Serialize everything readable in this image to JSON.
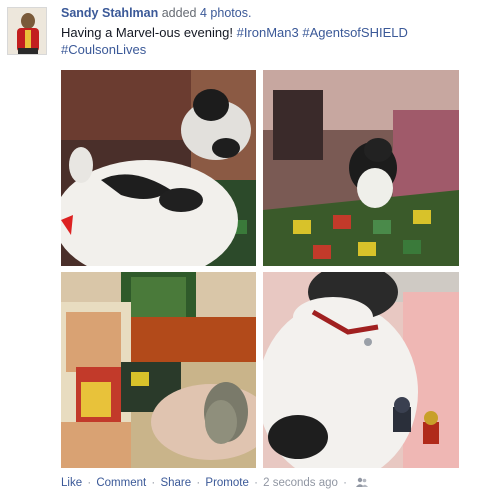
{
  "post": {
    "author": "Sandy Stahlman",
    "action": "added",
    "photo_count": "4 photos.",
    "message_text": "Having a Marvel-ous evening! ",
    "tags": [
      "#IronMan3",
      "#AgentsofSHIELD",
      "#CoulsonLives"
    ]
  },
  "footer": {
    "like": "Like",
    "comment": "Comment",
    "share": "Share",
    "promote": "Promote",
    "separator": "·",
    "timestamp": "2 seconds ago",
    "audience_icon": "friends-icon"
  },
  "colors": {
    "link": "#3b5998",
    "muted": "#9197a3"
  }
}
